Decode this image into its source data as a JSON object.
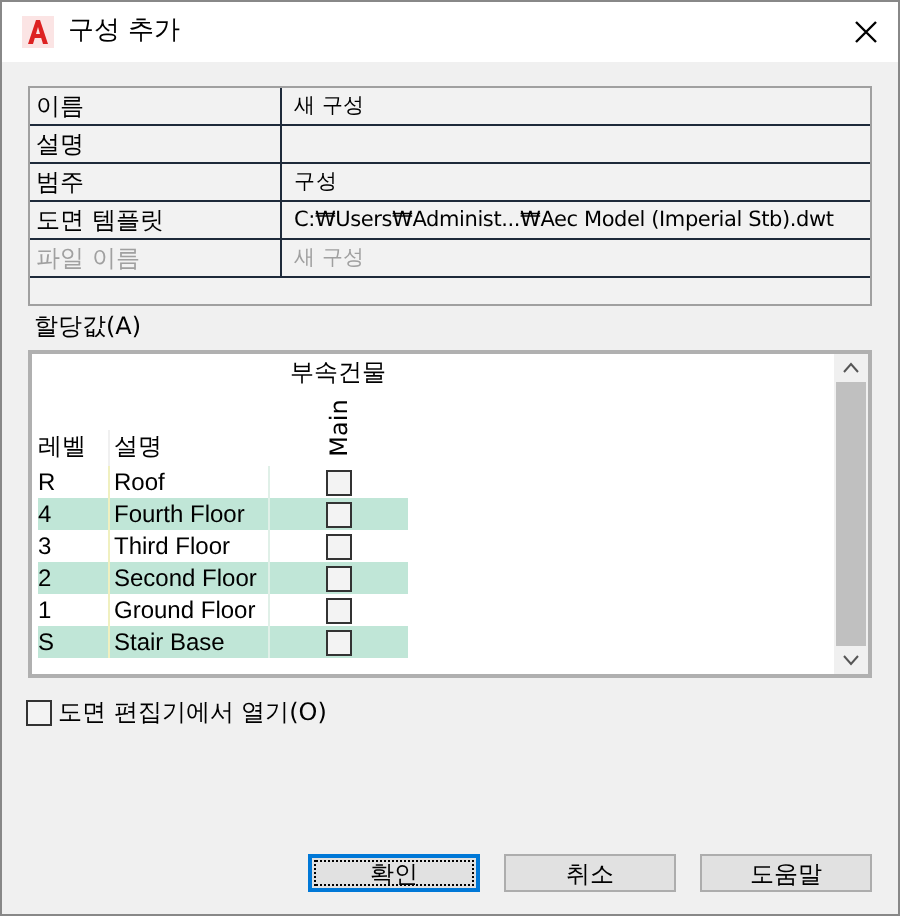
{
  "window": {
    "title": "구성 추가"
  },
  "properties": [
    {
      "label": "이름",
      "value": "새 구성",
      "disabled": false
    },
    {
      "label": "설명",
      "disabled": false
    },
    {
      "label": "범주",
      "value": "구성",
      "disabled": false
    },
    {
      "label": "도면 템플릿",
      "value": "C:₩Users₩Administ...₩Aec Model (Imperial Stb).dwt",
      "disabled": false
    },
    {
      "label": "파일 이름",
      "value": "새 구성",
      "disabled": true
    }
  ],
  "assignments_label": "할당값(A)",
  "table": {
    "group_header": "부속건물",
    "columns": [
      "레벨",
      "설명",
      "Main"
    ],
    "rows": [
      {
        "level": "R",
        "description": "Roof",
        "highlighted": false,
        "checked": false
      },
      {
        "level": "4",
        "description": "Fourth Floor",
        "highlighted": true,
        "checked": false
      },
      {
        "level": "3",
        "description": "Third Floor",
        "highlighted": false,
        "checked": false
      },
      {
        "level": "2",
        "description": "Second Floor",
        "highlighted": true,
        "checked": false
      },
      {
        "level": "1",
        "description": "Ground Floor",
        "highlighted": false,
        "checked": false
      },
      {
        "level": "S",
        "description": "Stair Base",
        "highlighted": true,
        "checked": false
      }
    ]
  },
  "open_in_editor": {
    "label": "도면 편집기에서 열기(O)",
    "checked": false
  },
  "buttons": [
    {
      "label": "확인",
      "selected": true
    },
    {
      "label": "취소",
      "selected": false
    },
    {
      "label": "도움말",
      "selected": false
    }
  ]
}
